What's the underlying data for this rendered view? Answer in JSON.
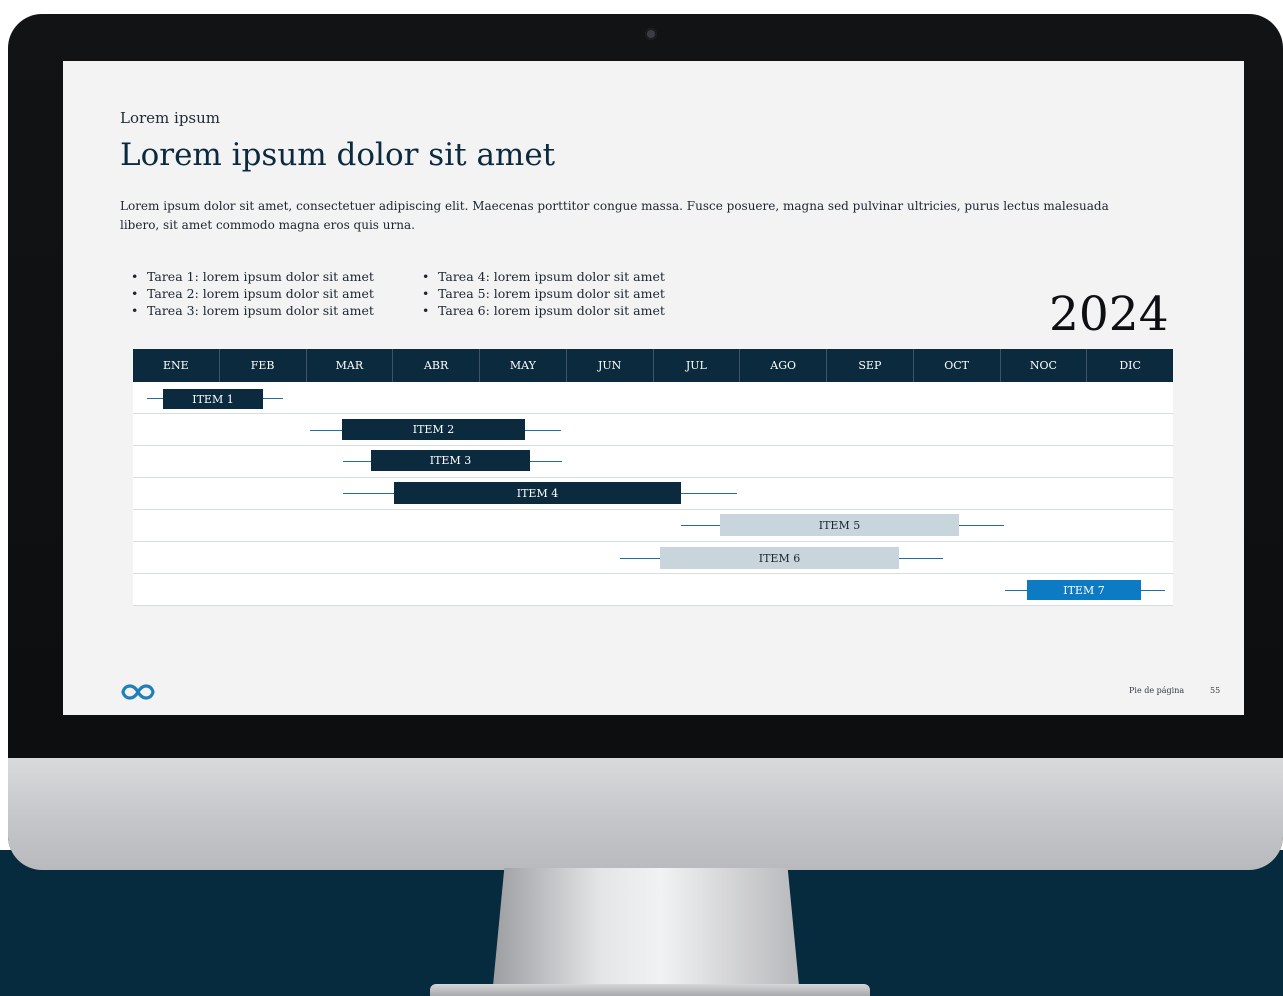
{
  "slide": {
    "kicker": "Lorem ipsum",
    "title": "Lorem ipsum dolor sit amet",
    "intro": "Lorem ipsum dolor sit amet, consectetuer adipiscing elit. Maecenas porttitor congue massa. Fusce posuere, magna sed pulvinar ultricies, purus lectus malesuada libero, sit amet commodo magna eros quis urna.",
    "tasks_left": [
      "Tarea 1:  lorem ipsum dolor sit amet",
      "Tarea 2:  lorem ipsum dolor sit amet",
      "Tarea 3:  lorem ipsum dolor sit amet"
    ],
    "tasks_right": [
      "Tarea 4:  lorem ipsum dolor sit amet",
      "Tarea 5:  lorem ipsum dolor sit amet",
      "Tarea 6:  lorem ipsum dolor sit amet"
    ],
    "year": "2024",
    "footer_label": "Pie de página",
    "page_number": "55",
    "logo_icon": "infinity-logo-icon"
  },
  "colors": {
    "navy": "#0b2a3e",
    "light_bar": "#c8d5dd",
    "accent_blue": "#0c7bc4",
    "backdrop": "#062a3e"
  },
  "gantt": {
    "months": [
      "ENE",
      "FEB",
      "MAR",
      "ABR",
      "MAY",
      "JUN",
      "JUL",
      "AGO",
      "SEP",
      "OCT",
      "NOC",
      "DIC"
    ],
    "items": [
      {
        "label": "ITEM 1",
        "style": "dark"
      },
      {
        "label": "ITEM 2",
        "style": "dark"
      },
      {
        "label": "ITEM 3",
        "style": "dark"
      },
      {
        "label": "ITEM 4",
        "style": "dark"
      },
      {
        "label": "ITEM 5",
        "style": "light"
      },
      {
        "label": "ITEM 6",
        "style": "light"
      },
      {
        "label": "ITEM 7",
        "style": "blue"
      }
    ]
  }
}
